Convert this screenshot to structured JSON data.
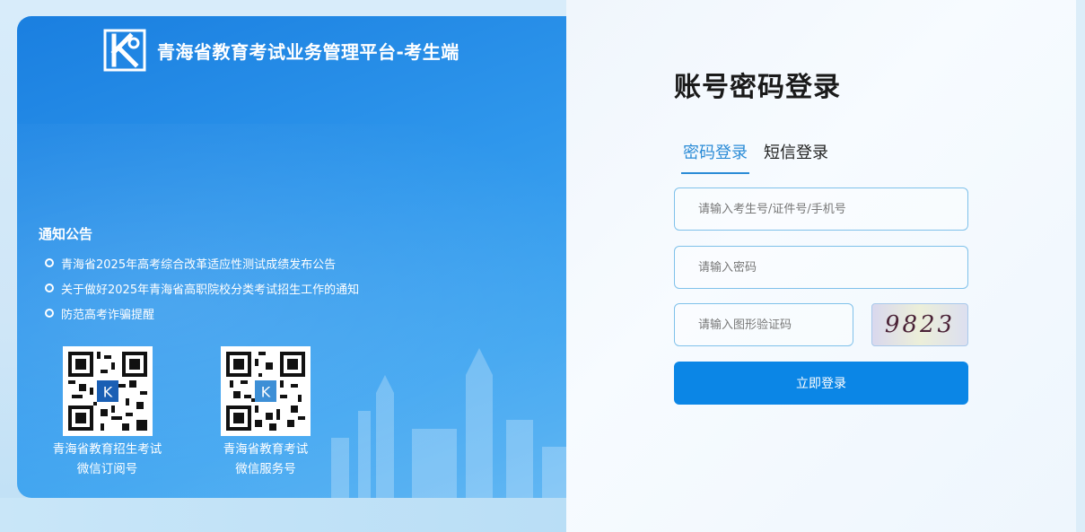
{
  "header": {
    "title": "青海省教育考试业务管理平台-考生端",
    "logo_icon": "k-logo-icon"
  },
  "notice": {
    "title": "通知公告",
    "items": [
      "青海省2025年高考综合改革适应性测试成绩发布公告",
      "关于做好2025年青海省高职院校分类考试招生工作的通知",
      "防范高考诈骗提醒"
    ]
  },
  "qrcodes": [
    {
      "line1": "青海省教育招生考试",
      "line2": "微信订阅号"
    },
    {
      "line1": "青海省教育考试",
      "line2": "微信服务号"
    }
  ],
  "login": {
    "title": "账号密码登录",
    "tabs": [
      "密码登录",
      "短信登录"
    ],
    "active_tab": "密码登录",
    "account_placeholder": "请输入考生号/证件号/手机号",
    "password_placeholder": "请输入密码",
    "captcha_placeholder": "请输入图形验证码",
    "captcha_text": "9823",
    "submit_label": "立即登录"
  },
  "colors": {
    "primary": "#0b86e6",
    "tab_active": "#2a8bd6",
    "panel_blue": "#2f97ec"
  }
}
